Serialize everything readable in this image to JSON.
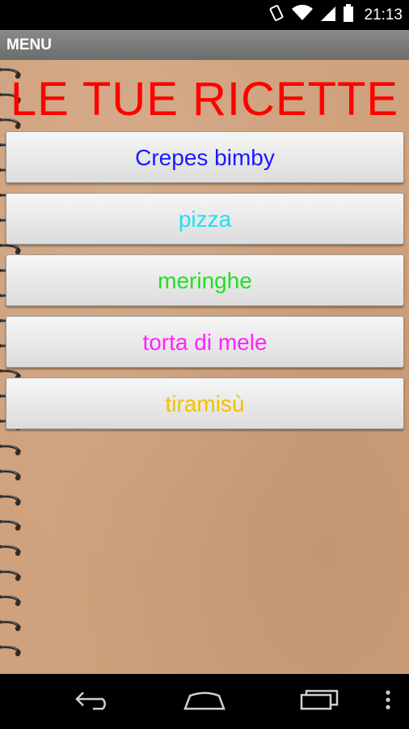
{
  "status_bar": {
    "time": "21:13",
    "icons": [
      "vibrate-icon",
      "wifi-icon",
      "signal-icon",
      "battery-icon"
    ]
  },
  "action_bar": {
    "title": "MENU"
  },
  "page": {
    "title": "LE TUE RICETTE",
    "title_color": "#ff0000"
  },
  "recipes": [
    {
      "label": "Crepes bimby",
      "color": "#1a1aff"
    },
    {
      "label": "pizza",
      "color": "#22e0f0"
    },
    {
      "label": "meringhe",
      "color": "#22e022"
    },
    {
      "label": "torta di mele",
      "color": "#ff22ff"
    },
    {
      "label": "tiramisù",
      "color": "#f2c200"
    }
  ],
  "nav_bar": {
    "icons": [
      "back-icon",
      "home-icon",
      "recent-apps-icon",
      "overflow-menu-icon"
    ]
  }
}
